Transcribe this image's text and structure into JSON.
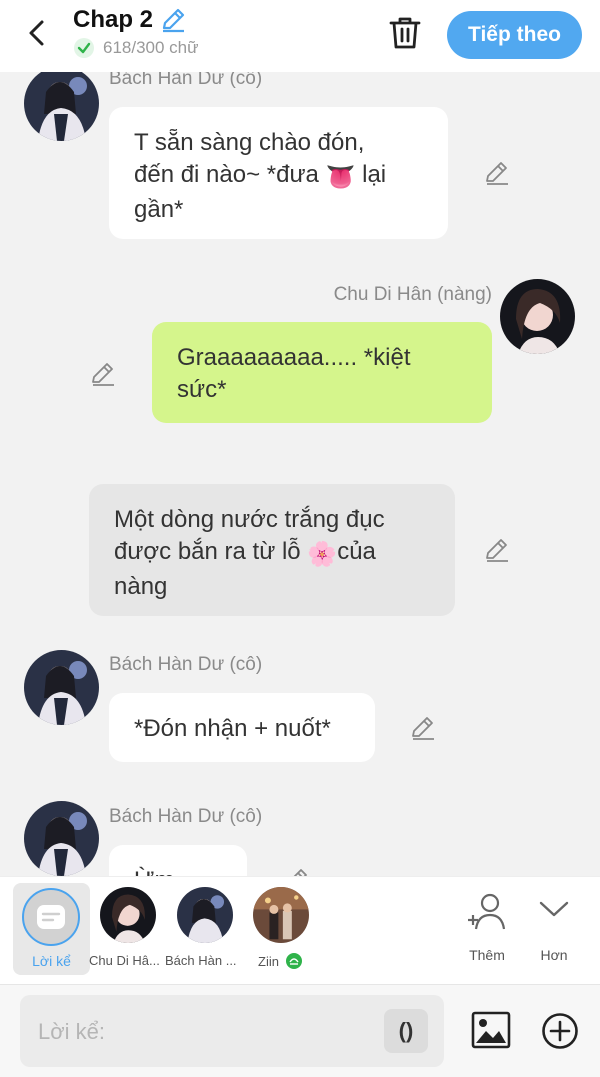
{
  "header": {
    "title": "Chap 2",
    "word_count": "618/300 chữ",
    "next_label": "Tiếp theo",
    "accent": "#51a8f0"
  },
  "messages": [
    {
      "sender": "Bách Hàn Dư (cô)",
      "text_1": "T sẵn sàng chào đón,",
      "text_2a": "đến đi nào~ *đưa ",
      "emoji": "👅",
      "text_2b": " lại",
      "text_3": "gần*",
      "bubble": "white"
    },
    {
      "sender": "Chu Di Hân (nàng)",
      "text_1": "Graaaaaaaaa..... *kiệt",
      "text_2": "sức*",
      "bubble": "#d5f58c"
    },
    {
      "text_1": "Một dòng nước trắng đục",
      "text_2a": "được bắn ra từ lỗ ",
      "emoji": "🌸",
      "text_2b": "của",
      "text_3": "nàng",
      "bubble": "gray"
    },
    {
      "sender": "Bách Hàn Dư (cô)",
      "text": "*Đón nhận + nuốt*",
      "bubble": "white"
    },
    {
      "sender": "Bách Hàn Dư (cô)",
      "text": "Ừm",
      "bubble": "white"
    }
  ],
  "characters": {
    "narration_label": "Lời kể",
    "items": [
      "Chu Di Hâ...",
      "Bách Hàn ...",
      "Ziin"
    ],
    "add_label": "Thêm",
    "more_label": "Hơn"
  },
  "input": {
    "placeholder": "Lời kể:",
    "paren_label": "()"
  }
}
